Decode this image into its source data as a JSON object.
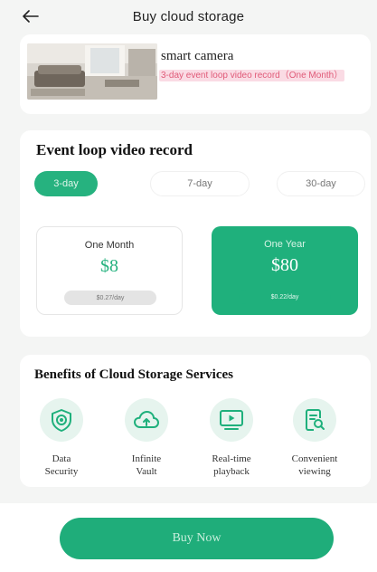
{
  "header": {
    "title": "Buy cloud storage",
    "back_icon": "arrow-left-icon"
  },
  "product": {
    "name": "smart camera",
    "tag": "3-day event loop video record（One Month）"
  },
  "plan": {
    "section_title": "Event loop video record",
    "tabs": [
      {
        "label": "3-day",
        "active": true
      },
      {
        "label": "7-day",
        "active": false
      },
      {
        "label": "30-day",
        "active": false
      }
    ],
    "options": [
      {
        "period": "One Month",
        "price": "$8",
        "note": "$0.27/day",
        "selected": false
      },
      {
        "period": "One Year",
        "price": "$80",
        "note": "$0.22/day",
        "selected": true
      }
    ]
  },
  "benefits": {
    "title": "Benefits of Cloud Storage Services",
    "items": [
      {
        "label": "Data\nSecurity",
        "icon": "shield-eye-icon"
      },
      {
        "label": "Infinite\nVault",
        "icon": "cloud-icon"
      },
      {
        "label": "Real-time\nplayback",
        "icon": "play-screen-icon"
      },
      {
        "label": "Convenient\nviewing",
        "icon": "document-search-icon"
      }
    ]
  },
  "footer": {
    "buy_label": "Buy Now"
  },
  "colors": {
    "accent": "#1fb07c",
    "tag_pink": "#e05a78",
    "tag_pink_bg": "#fadbe4",
    "icon_bg": "#e6f4ee"
  }
}
